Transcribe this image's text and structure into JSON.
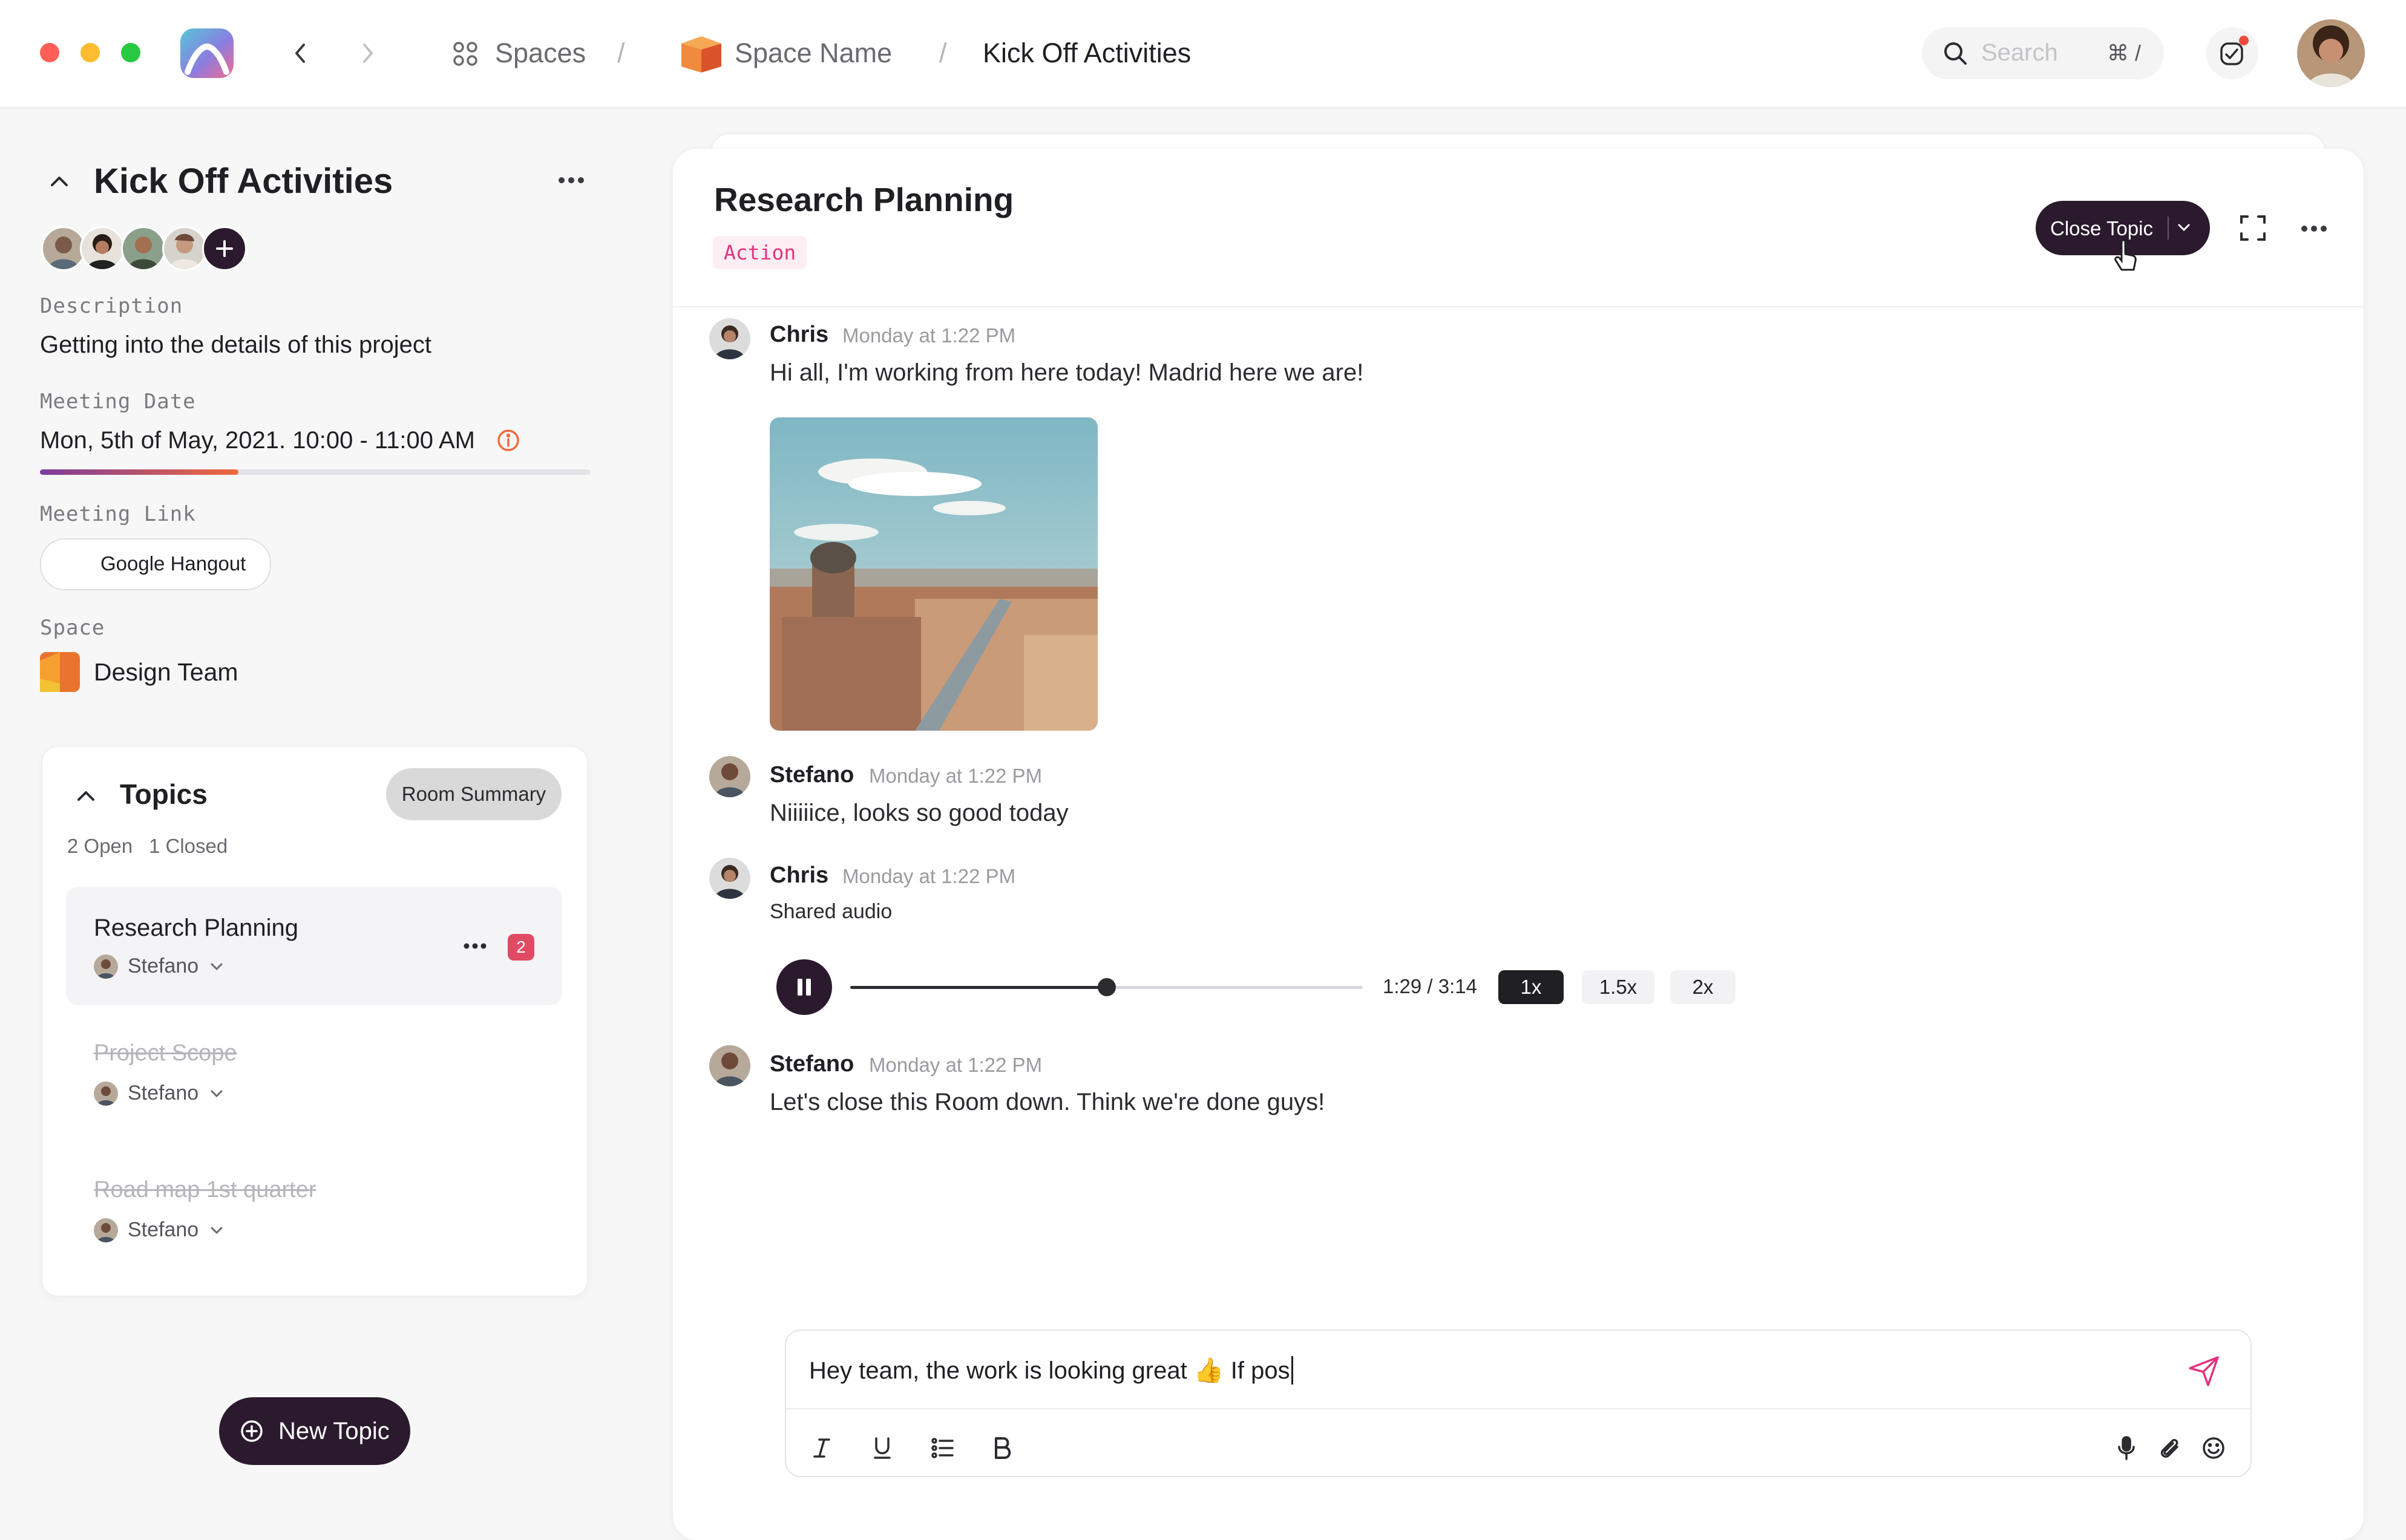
{
  "window": {
    "traffic_light_colors": [
      "#ff5f57",
      "#febc2e",
      "#28c840"
    ]
  },
  "breadcrumb": {
    "spaces": "Spaces",
    "separator": "/",
    "space_name": "Space Name",
    "current": "Kick Off Activities"
  },
  "search": {
    "placeholder": "Search",
    "shortcut": "⌘ /"
  },
  "room": {
    "title": "Kick Off Activities",
    "description_label": "Description",
    "description": "Getting into the details of this project",
    "meeting_date_label": "Meeting Date",
    "meeting_date": "Mon, 5th of May, 2021. 10:00 - 11:00 AM",
    "meeting_progress": 0.36,
    "meeting_link_label": "Meeting Link",
    "meeting_link": "Google Hangout",
    "space_label": "Space",
    "space_name": "Design Team"
  },
  "topics": {
    "title": "Topics",
    "summary_button": "Room Summary",
    "open_count": "2 Open",
    "closed_count": "1 Closed",
    "items": [
      {
        "title": "Research Planning",
        "owner": "Stefano",
        "badge": "2",
        "closed": false
      },
      {
        "title": "Project Scope",
        "owner": "Stefano",
        "closed": true
      },
      {
        "title": "Road map 1st quarter",
        "owner": "Stefano",
        "closed": true
      }
    ],
    "new_topic": "New Topic"
  },
  "topic": {
    "title": "Research Planning",
    "tag": "Action",
    "close_button": "Close Topic"
  },
  "messages": [
    {
      "author": "Chris",
      "time": "Monday at 1:22 PM",
      "text": "Hi all, I'm working from here today! Madrid here we are!"
    },
    {
      "author": "Stefano",
      "time": "Monday at 1:22 PM",
      "text": "Niiiiice, looks so good today"
    },
    {
      "author": "Chris",
      "time": "Monday at 1:22 PM",
      "text": "Shared audio"
    },
    {
      "author": "Stefano",
      "time": "Monday at 1:22 PM",
      "text": "Let's close this Room down. Think we're done guys!"
    }
  ],
  "audio": {
    "time": "1:29 / 3:14",
    "progress": 0.5,
    "speeds": [
      "1x",
      "1.5x",
      "2x"
    ],
    "active_speed": "1x"
  },
  "composer": {
    "value": "Hey team, the work is looking great 👍 If pos"
  },
  "icons": {
    "grid": "grid-icon",
    "search": "search-icon",
    "notifications": "notification-icon",
    "send": "send-icon",
    "italic": "italic-icon",
    "underline": "underline-icon",
    "list": "list-icon",
    "bold": "bold-icon",
    "mic": "mic-icon",
    "attach": "paperclip-icon",
    "emoji": "emoji-icon"
  },
  "colors": {
    "accent_dark": "#2b1a2e",
    "tag_pink": "#e0347d",
    "badge_red": "#e04b63",
    "info_orange": "#f06a3a"
  }
}
